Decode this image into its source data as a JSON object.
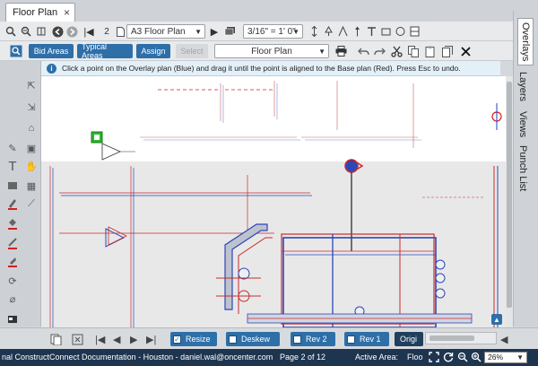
{
  "tab": {
    "title": "Floor Plan",
    "close": "×"
  },
  "toolbar1": {
    "page_number": "2",
    "sheet_name": "A3 Floor Plan",
    "scale": "3/16\" = 1' 0\""
  },
  "toolbar2": {
    "bid_areas": "Bid Areas",
    "typical_areas": "Typical Areas",
    "assign": "Assign",
    "select": "Select",
    "layer_select": "Floor Plan"
  },
  "banner": {
    "message": "Click a point on the Overlay plan (Blue) and drag it until the point is aligned to the Base plan (Red). Press Esc to undo."
  },
  "side_tabs": [
    "Overlays",
    "Layers",
    "Views",
    "Punch List"
  ],
  "bottom": {
    "resize": "Resize",
    "deskew": "Deskew",
    "rev2": "Rev 2",
    "rev1": "Rev 1",
    "origin": "Origi"
  },
  "status": {
    "app": "nal ConstructConnect Documentation - Houston - daniel.wal@oncenter.com",
    "page": "Page 2 of 12",
    "active_area_label": "Active Area:",
    "active_area_value": "Floo",
    "zoom": "26%"
  },
  "colors": {
    "accent": "#2e6fa8",
    "status_bg": "#1e3550",
    "base_plan": "#d42020",
    "overlay_plan": "#2040c0"
  },
  "icons": [
    "search-icon",
    "zoom-icon",
    "back-icon",
    "forward-icon",
    "first-page-icon",
    "prev-page-icon",
    "next-page-icon",
    "page-icon",
    "monitor-icon",
    "print-icon",
    "undo-icon",
    "redo-icon",
    "cut-icon",
    "copy-icon",
    "paste-icon",
    "close-icon",
    "info-icon"
  ]
}
